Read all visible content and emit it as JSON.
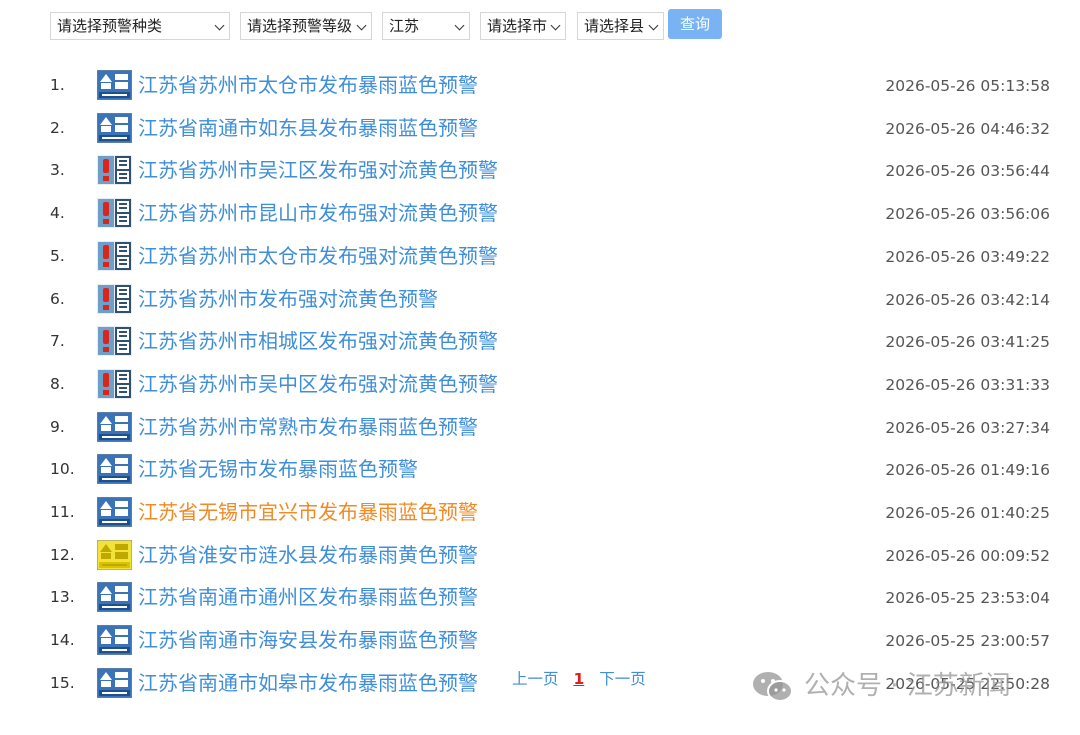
{
  "filters": {
    "type_select": "请选择预警种类",
    "level_select": "请选择预警等级",
    "province_select": "江苏",
    "city_select": "请选择市",
    "county_select": "请选择县",
    "query_button": "查询"
  },
  "colors": {
    "link": "#3f8ed8",
    "visited_link": "#f08a24",
    "query_button": "#79b3f3",
    "current_page": "#e02020"
  },
  "warnings": [
    {
      "num": "1.",
      "icon": "rainstorm-blue-icon",
      "title": "江苏省苏州市太仓市发布暴雨蓝色预警",
      "time": "2026-05-26 05:13:58"
    },
    {
      "num": "2.",
      "icon": "rainstorm-blue-icon",
      "title": "江苏省南通市如东县发布暴雨蓝色预警",
      "time": "2026-05-26 04:46:32"
    },
    {
      "num": "3.",
      "icon": "convection-alert-icon",
      "title": "江苏省苏州市吴江区发布强对流黄色预警",
      "time": "2026-05-26 03:56:44"
    },
    {
      "num": "4.",
      "icon": "convection-alert-icon",
      "title": "江苏省苏州市昆山市发布强对流黄色预警",
      "time": "2026-05-26 03:56:06"
    },
    {
      "num": "5.",
      "icon": "convection-alert-icon",
      "title": "江苏省苏州市太仓市发布强对流黄色预警",
      "time": "2026-05-26 03:49:22"
    },
    {
      "num": "6.",
      "icon": "convection-alert-icon",
      "title": "江苏省苏州市发布强对流黄色预警",
      "time": "2026-05-26 03:42:14"
    },
    {
      "num": "7.",
      "icon": "convection-alert-icon",
      "title": "江苏省苏州市相城区发布强对流黄色预警",
      "time": "2026-05-26 03:41:25"
    },
    {
      "num": "8.",
      "icon": "convection-alert-icon",
      "title": "江苏省苏州市吴中区发布强对流黄色预警",
      "time": "2026-05-26 03:31:33"
    },
    {
      "num": "9.",
      "icon": "rainstorm-blue-icon",
      "title": "江苏省苏州市常熟市发布暴雨蓝色预警",
      "time": "2026-05-26 03:27:34"
    },
    {
      "num": "10.",
      "icon": "rainstorm-blue-icon",
      "title": "江苏省无锡市发布暴雨蓝色预警",
      "time": "2026-05-26 01:49:16"
    },
    {
      "num": "11.",
      "icon": "rainstorm-blue-icon",
      "title": "江苏省无锡市宜兴市发布暴雨蓝色预警",
      "time": "2026-05-26 01:40:25",
      "visited": true
    },
    {
      "num": "12.",
      "icon": "rainstorm-yellow-icon",
      "title": "江苏省淮安市涟水县发布暴雨黄色预警",
      "time": "2026-05-26 00:09:52"
    },
    {
      "num": "13.",
      "icon": "rainstorm-blue-icon",
      "title": "江苏省南通市通州区发布暴雨蓝色预警",
      "time": "2026-05-25 23:53:04"
    },
    {
      "num": "14.",
      "icon": "rainstorm-blue-icon",
      "title": "江苏省南通市海安县发布暴雨蓝色预警",
      "time": "2026-05-25 23:00:57"
    },
    {
      "num": "15.",
      "icon": "rainstorm-blue-icon",
      "title": "江苏省南通市如皋市发布暴雨蓝色预警",
      "time": "2026-05-25 22:50:28"
    }
  ],
  "pager": {
    "prev": "上一页",
    "current": "1",
    "next": "下一页"
  },
  "watermark": {
    "icon": "wechat-icon",
    "text": "公众号 · 江苏新闻"
  }
}
